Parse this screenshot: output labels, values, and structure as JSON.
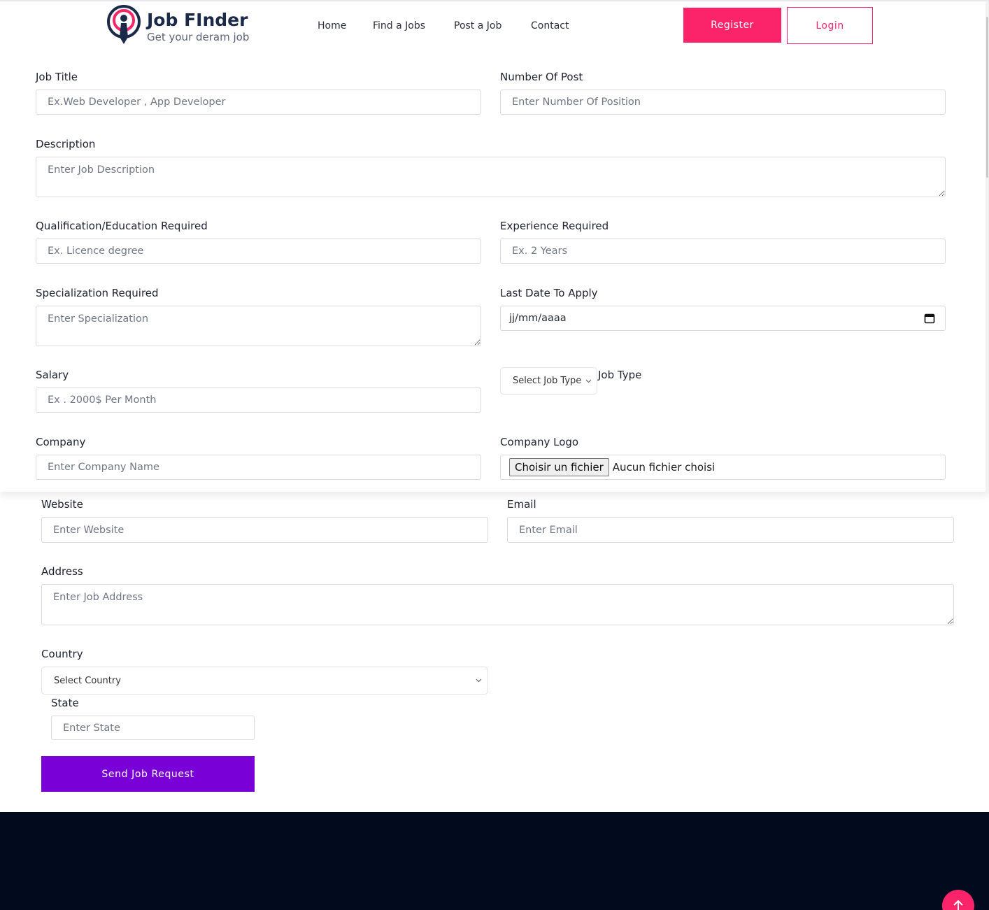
{
  "brand": {
    "title": "Job FInder",
    "tagline": "Get your deram job",
    "accent_color": "#fb246a"
  },
  "nav": {
    "items": [
      "Home",
      "Find a Jobs",
      "Post a Job",
      "Contact"
    ]
  },
  "auth": {
    "register_label": "Register",
    "login_label": "Login"
  },
  "form": {
    "job_title": {
      "label": "Job Title",
      "placeholder": "Ex.Web Developer , App Developer"
    },
    "number_of_post": {
      "label": "Number Of Post",
      "placeholder": "Enter Number Of Position"
    },
    "description": {
      "label": "Description",
      "placeholder": "Enter Job Description"
    },
    "qualification": {
      "label": "Qualification/Education Required",
      "placeholder": "Ex. Licence degree"
    },
    "experience": {
      "label": "Experience Required",
      "placeholder": "Ex. 2 Years"
    },
    "specialization": {
      "label": "Specialization Required",
      "placeholder": "Enter Specialization"
    },
    "last_date": {
      "label": "Last Date To Apply",
      "value": "jj/mm/aaaa"
    },
    "salary": {
      "label": "Salary",
      "placeholder": "Ex . 2000$ Per Month"
    },
    "job_type": {
      "label": "Job Type",
      "selected": "Select Job Type"
    },
    "company": {
      "label": "Company",
      "placeholder": "Enter Company Name"
    },
    "company_logo": {
      "label": "Company Logo",
      "button": "Choisir un fichier",
      "status": "Aucun fichier choisi"
    },
    "website": {
      "label": "Website",
      "placeholder": "Enter Website"
    },
    "email": {
      "label": "Email",
      "placeholder": "Enter Email"
    },
    "address": {
      "label": "Address",
      "placeholder": "Enter Job Address"
    },
    "country": {
      "label": "Country",
      "selected": "Select Country"
    },
    "state": {
      "label": "State",
      "placeholder": "Enter State"
    },
    "submit_label": "Send Job Request",
    "submit_color": "#7a00d8"
  },
  "footer": {
    "background": "#010b1d"
  },
  "icons": {
    "back_to_top": "arrow-up-icon",
    "calendar": "calendar-icon",
    "logo": "location-pin-icon"
  }
}
